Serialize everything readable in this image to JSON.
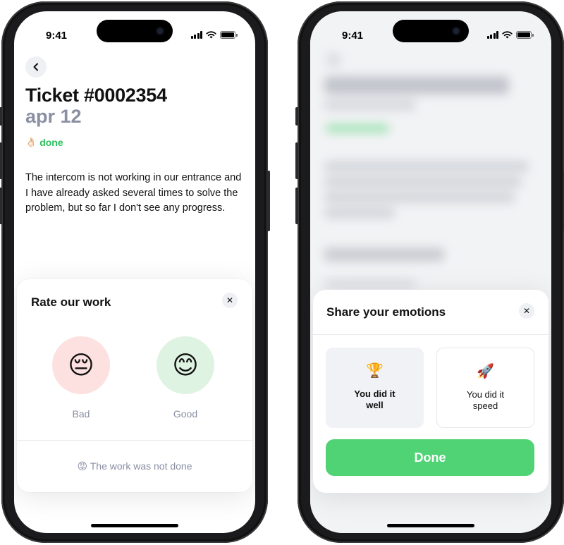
{
  "status_bar": {
    "time": "9:41"
  },
  "left_screen": {
    "ticket_title": "Ticket #0002354",
    "ticket_date": "apr 12",
    "status_icon": "👌🏻",
    "status_label": "done",
    "description": "The intercom is not working in our entrance and I have already asked several times to solve the problem, but so far I don't see any progress.",
    "rating_sheet": {
      "title": "Rate our work",
      "close_symbol": "✕",
      "options": [
        {
          "emoji": "😔",
          "label": "Bad",
          "bg": "#fde0e0"
        },
        {
          "emoji": "😊",
          "label": "Good",
          "bg": "#dff3e2"
        }
      ],
      "not_done_emoji": "😡",
      "not_done_label": "The work was not done"
    }
  },
  "right_screen": {
    "emotions_sheet": {
      "title": "Share your emotions",
      "close_symbol": "✕",
      "cards": [
        {
          "emoji": "🏆",
          "label": "You did it well",
          "selected": true
        },
        {
          "emoji": "🚀",
          "label": "You did it speed",
          "selected": false
        }
      ],
      "done_label": "Done"
    }
  },
  "colors": {
    "accent_green": "#4fd374",
    "status_green": "#28c05a",
    "muted_text": "#8a8fa3"
  },
  "icons": {
    "back": "chevron-left-icon",
    "close": "close-icon",
    "signal": "cellular-signal-icon",
    "wifi": "wifi-icon",
    "battery": "battery-icon"
  }
}
